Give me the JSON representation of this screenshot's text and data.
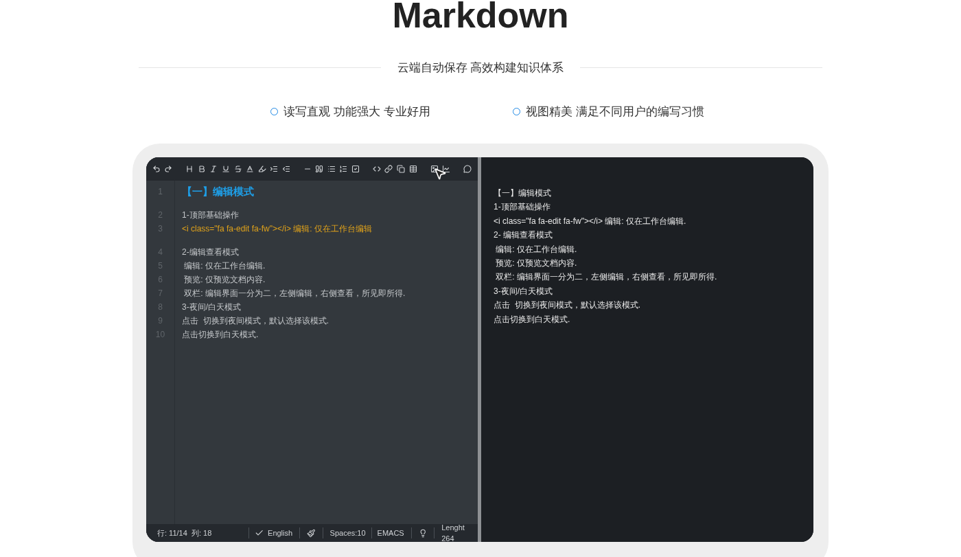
{
  "header": {
    "title": "Markdown",
    "subtitle": "云端自动保存 高效构建知识体系"
  },
  "features": [
    "读写直观 功能强大 专业好用",
    "视图精美 满足不同用户的编写习惯"
  ],
  "editor": {
    "lines": [
      {
        "number": "1",
        "kind": "heading",
        "text": "【一】编辑模式"
      },
      {
        "number": "2",
        "kind": "text",
        "text": "1-顶部基础操作"
      },
      {
        "number": "3",
        "kind": "code",
        "text": "<i class=\"fa fa-edit fa-fw\"></i> 编辑: 仅在工作台编辑"
      },
      {
        "number": "4",
        "kind": "text",
        "text": "2-编辑查看模式"
      },
      {
        "number": "5",
        "kind": "text",
        "text": " 编辑: 仅在工作台编辑."
      },
      {
        "number": "6",
        "kind": "text",
        "text": " 预览: 仅预览文档内容."
      },
      {
        "number": "7",
        "kind": "text",
        "text": " 双栏: 编辑界面一分为二，左侧编辑，右侧查看，所见即所得."
      },
      {
        "number": "8",
        "kind": "text",
        "text": "3-夜间/白天模式"
      },
      {
        "number": "9",
        "kind": "text",
        "text": "点击  切换到夜间模式，默认选择该模式."
      },
      {
        "number": "10",
        "kind": "text",
        "text": "点击切换到白天模式."
      }
    ]
  },
  "preview": {
    "lines": [
      "【一】编辑模式",
      "1-顶部基础操作",
      "<i class=\"fa fa-edit fa-fw\"></i> 编辑: 仅在工作台编辑.",
      "2- 编辑查看模式",
      " 编辑: 仅在工作台编辑.",
      " 预览: 仅预览文档内容.",
      " 双栏: 编辑界面一分为二，左侧编辑，右侧查看，所见即所得.",
      "3-夜间/白天模式",
      "点击  切换到夜间模式，默认选择该模式.",
      "点击切换到白天模式."
    ]
  },
  "status_bar": {
    "position": "行: 11/14  列: 18",
    "language": "English",
    "spaces": "Spaces:10",
    "keymap": "EMACS",
    "length": "Lenght 264"
  }
}
